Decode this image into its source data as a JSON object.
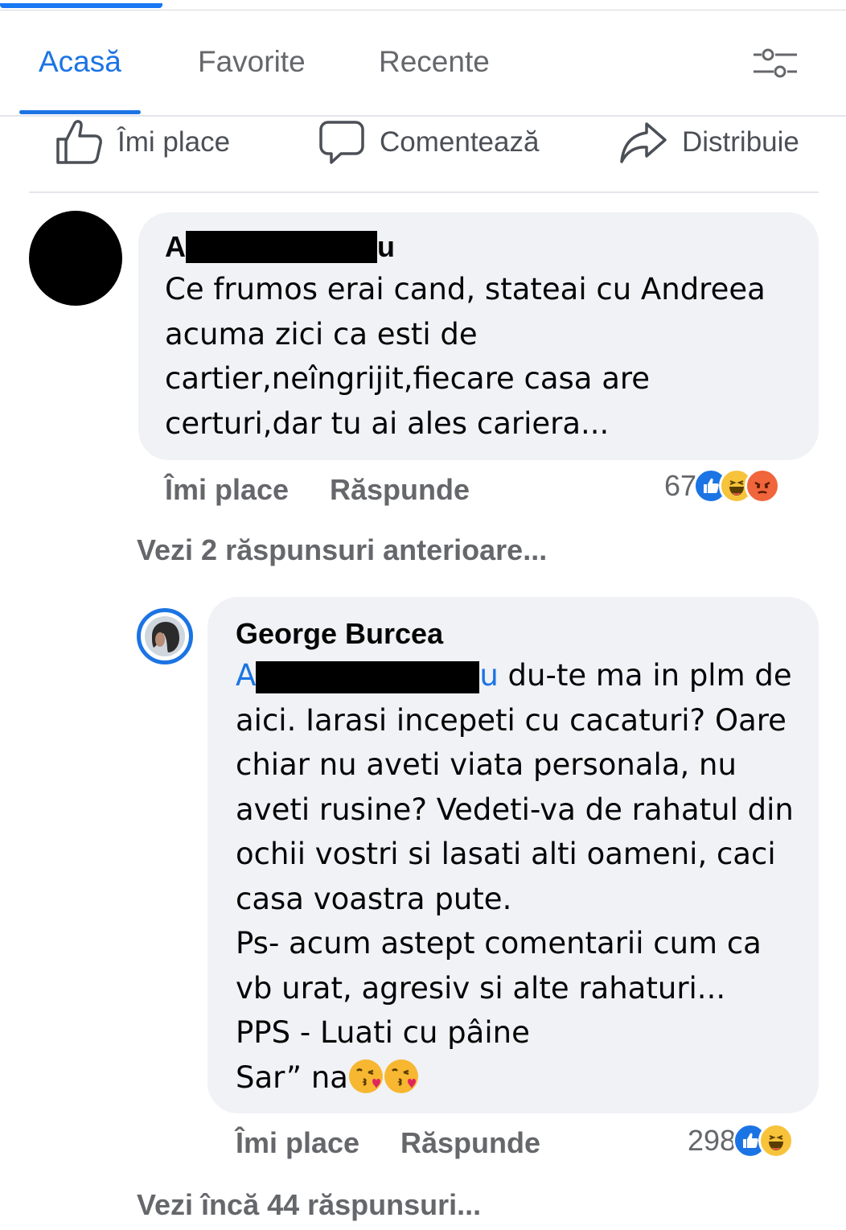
{
  "nav": {
    "tabs": [
      {
        "label": "Acasă",
        "active": true
      },
      {
        "label": "Favorite",
        "active": false
      },
      {
        "label": "Recente",
        "active": false
      }
    ],
    "filter_icon": "sliders-icon",
    "accent_color": "#1b74e4"
  },
  "post_actions": {
    "like": "Îmi place",
    "comment": "Comentează",
    "share": "Distribuie"
  },
  "comments": [
    {
      "author_start": "A",
      "author_end": "u",
      "lines": [
        "Ce frumos erai cand, stateai cu Andreea",
        "acuma zici ca esti de",
        "cartier,neîngrijit,fiecare casa are",
        "certuri,dar tu ai ales cariera..."
      ],
      "like_label": "Îmi place",
      "reply_label": "Răspunde",
      "reaction_count": "67",
      "reactions": [
        "like",
        "haha",
        "angry"
      ],
      "more_replies": "Vezi 2 răspunsuri anterioare..."
    },
    {
      "author": "George Burcea",
      "mention_start": "A",
      "mention_end": "u",
      "first_line_rest": " du-te ma in plm de",
      "lines": [
        "aici. Iarasi incepeti cu cacaturi? Oare",
        "chiar nu aveti viata personala, nu",
        "aveti rusine? Vedeti-va de rahatul din",
        "ochii vostri si lasati alti oameni, caci",
        "casa voastra pute.",
        "Ps- acum astept comentarii cum ca",
        "vb urat, agresiv si alte rahaturi...",
        "PPS - Luati cu pâine"
      ],
      "last_line_text": "Sar” na",
      "last_line_emojis": [
        "kissing-heart-emoji",
        "kissing-heart-emoji"
      ],
      "like_label": "Îmi place",
      "reply_label": "Răspunde",
      "reaction_count": "298",
      "reactions": [
        "like",
        "haha"
      ],
      "more_replies": "Vezi încă 44 răspunsuri..."
    }
  ]
}
